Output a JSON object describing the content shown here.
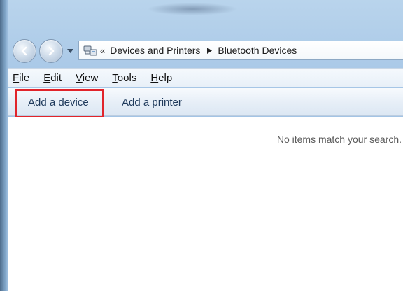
{
  "navigation": {
    "back_icon": "back-arrow-icon",
    "forward_icon": "forward-arrow-icon",
    "history_icon": "chevron-down-icon"
  },
  "address": {
    "location_icon": "devices-printers-icon",
    "overflow": "«",
    "crumbs": [
      "Devices and Printers",
      "Bluetooth Devices"
    ]
  },
  "menu": {
    "items": [
      {
        "accel": "F",
        "rest": "ile"
      },
      {
        "accel": "E",
        "rest": "dit"
      },
      {
        "accel": "V",
        "rest": "iew"
      },
      {
        "accel": "T",
        "rest": "ools"
      },
      {
        "accel": "H",
        "rest": "elp"
      }
    ]
  },
  "commands": {
    "add_device": "Add a device",
    "add_printer": "Add a printer"
  },
  "content": {
    "empty_message": "No items match your search."
  },
  "colors": {
    "highlight": "#e1242b",
    "frame": "#a6c6e6",
    "command_text": "#1e395b"
  }
}
